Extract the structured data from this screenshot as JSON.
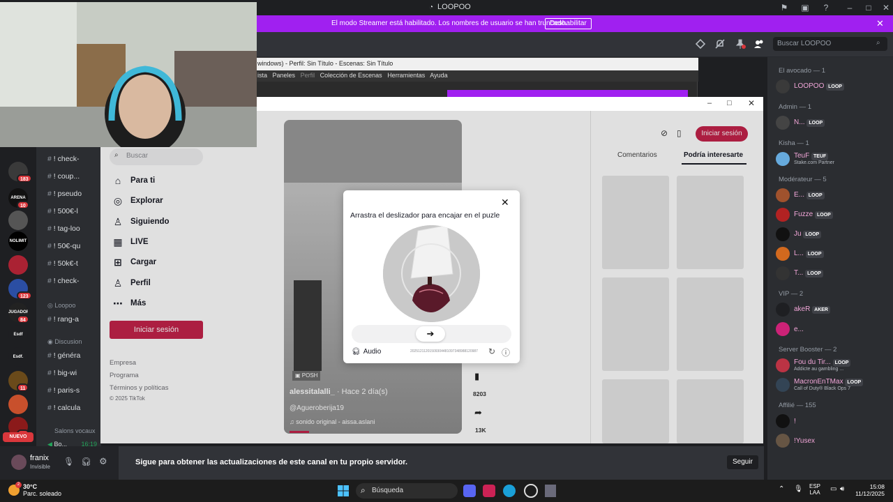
{
  "app": {
    "title": "LOOPOO"
  },
  "banner": {
    "message": "El modo Streamer está habilitado. Los nombres de usuario se han truncado.",
    "button": "Deshabilitar"
  },
  "topbar": {
    "search_placeholder": "Buscar LOOPOO"
  },
  "obs": {
    "title": "windows) - Perfil: Sin Título - Escenas: Sin Título",
    "menu": [
      "ista",
      "Paneles",
      "Perfil",
      "Colección de Escenas",
      "Herramientas",
      "Ayuda"
    ]
  },
  "servers": [
    {
      "label": "",
      "badge": "183",
      "color": "#3a3a3a"
    },
    {
      "label": "ARENA",
      "badge": "10",
      "color": "#111111"
    },
    {
      "label": "",
      "badge": "",
      "color": "#555555"
    },
    {
      "label": "NOLIMIT",
      "badge": "",
      "color": "#000000"
    },
    {
      "label": "",
      "badge": "",
      "color": "#a23"
    },
    {
      "label": "",
      "badge": "123",
      "color": "#2b4ea3"
    },
    {
      "label": "JUGADOR",
      "badge": "84",
      "color": "#222"
    },
    {
      "label": "Esdf",
      "badge": "",
      "color": "#1e1f22"
    },
    {
      "label": "Esdf.",
      "badge": "",
      "color": "#1e1f22"
    },
    {
      "label": "",
      "badge": "11",
      "color": "#6a4a1a"
    },
    {
      "label": "",
      "badge": "",
      "color": "#c8502c"
    },
    {
      "label": "",
      "badge": "16",
      "color": "#8b1a1a"
    }
  ],
  "new_label": "NUEVO",
  "channels": [
    {
      "prefix": "#",
      "text": "! check-"
    },
    {
      "prefix": "#",
      "text": "! coup..."
    },
    {
      "prefix": "#",
      "text": "! pseudo"
    },
    {
      "prefix": "#",
      "text": "! 500€-l"
    },
    {
      "prefix": "#",
      "text": "! tag-loo"
    },
    {
      "prefix": "#",
      "text": "! 50€-qu"
    },
    {
      "prefix": "#",
      "text": "! 50k€-t"
    },
    {
      "prefix": "#",
      "text": "! check-"
    }
  ],
  "cat_loopoo": "Loopoo",
  "channel_rang": "! rang-a",
  "cat_discussion": "Discusion",
  "channels2": [
    "! généra",
    "! big-wi",
    "! paris-s",
    "! calcula"
  ],
  "cat_salons": "Salons vocaux",
  "voice_channel": "Bo...",
  "voice_time": "16:19",
  "user": {
    "name": "franix",
    "status": "Invisible"
  },
  "chat": {
    "notice": "Sigue para obtener las actualizaciones de este canal en tu propio servidor.",
    "follow": "Seguir"
  },
  "tiktok": {
    "search_placeholder": "Buscar",
    "nav": [
      "Para ti",
      "Explorar",
      "Siguiendo",
      "LIVE",
      "Cargar",
      "Perfil",
      "Más"
    ],
    "login": "Iniciar sesión",
    "footer": [
      "Empresa",
      "Programa",
      "Términos y políticas",
      "© 2025 TikTok"
    ],
    "tabs": [
      "Comentarios",
      "Podría interesarte"
    ],
    "video": {
      "tag": "POSH",
      "author": "alessitalalli_",
      "time": "· Hace 2 día(s)",
      "mention": "@Agueroberija19",
      "sound": "sonido original - aissa.aslani",
      "bookmarks": "8203",
      "shares": "13K"
    }
  },
  "captcha": {
    "instruction": "Arrastra el deslizador para encajar en el puzle",
    "audio": "Audio",
    "code": "20251211201509304481097348988120987"
  },
  "members": {
    "groups": [
      {
        "role": "El avocado — 1",
        "items": [
          {
            "name": "LOOPOO",
            "tag": "LOOP",
            "color": "#3a3a3a",
            "sub": ""
          }
        ]
      },
      {
        "role": "Admin — 1",
        "items": [
          {
            "name": "N...",
            "tag": "LOOP",
            "color": "#444",
            "sub": ""
          }
        ]
      },
      {
        "role": "Kisha — 1",
        "items": [
          {
            "name": "TeuF",
            "tag": "TEUF",
            "color": "#66aadd",
            "sub": "Stake.com Partner"
          }
        ]
      },
      {
        "role": "Modérateur — 5",
        "items": [
          {
            "name": "E...",
            "tag": "LOOP",
            "color": "#a0522d",
            "sub": ""
          },
          {
            "name": "Fuzze",
            "tag": "LOOP",
            "color": "#b22222",
            "sub": ""
          },
          {
            "name": "Ju",
            "tag": "LOOP",
            "color": "#111",
            "sub": ""
          },
          {
            "name": "L...",
            "tag": "LOOP",
            "color": "#d2691e",
            "sub": ""
          },
          {
            "name": "T...",
            "tag": "LOOP",
            "color": "#333",
            "sub": ""
          }
        ]
      },
      {
        "role": "VIP — 2",
        "items": [
          {
            "name": "akeR",
            "tag": "AKER",
            "color": "#1e1f22",
            "sub": ""
          },
          {
            "name": "e...",
            "tag": "",
            "color": "#c27",
            "sub": ""
          }
        ]
      },
      {
        "role": "Server Booster — 2",
        "items": [
          {
            "name": "Fou du Tir...",
            "tag": "LOOP",
            "color": "#b34",
            "sub": "Addicte au gambling ..."
          },
          {
            "name": "MacronEnTMax",
            "tag": "LOOP",
            "color": "#345",
            "sub": "Call of Duty® Black Ops 7"
          }
        ]
      },
      {
        "role": "Affilié — 155",
        "items": [
          {
            "name": "!",
            "tag": "",
            "color": "#111",
            "sub": ""
          },
          {
            "name": "!Yusex",
            "tag": "",
            "color": "#654",
            "sub": ""
          }
        ]
      }
    ]
  },
  "taskbar": {
    "temp": "30°C",
    "weather": "Parc. soleado",
    "search": "Búsqueda",
    "lang1": "ESP",
    "lang2": "LAA",
    "time": "15:08",
    "date": "11/12/2025"
  },
  "colors": {
    "accent": "#a020f0",
    "tiktok": "#c4234b",
    "discord_bg": "#313338"
  }
}
